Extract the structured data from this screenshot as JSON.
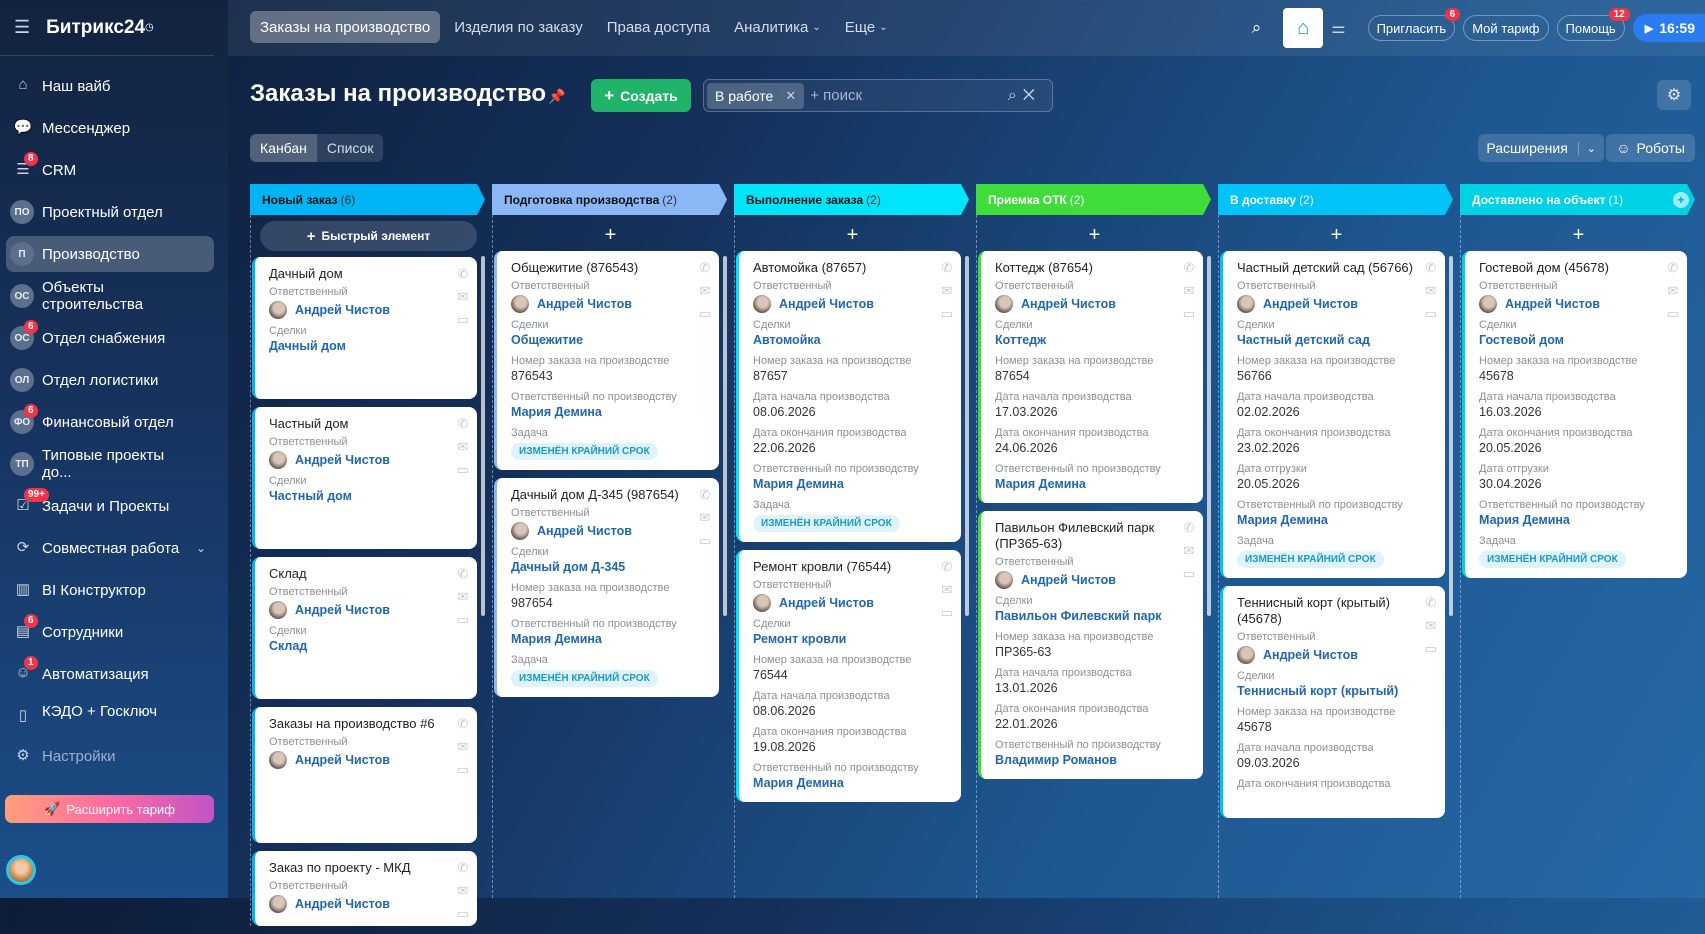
{
  "app": {
    "logo": "Битрикс24",
    "logo_mark": "◷"
  },
  "sidebar": {
    "items": [
      {
        "label": "Наш вайб",
        "icon": "home-icon",
        "glyph": "⌂"
      },
      {
        "label": "Мессенджер",
        "icon": "chat-icon",
        "glyph": "💬"
      },
      {
        "label": "CRM",
        "icon": "funnel-icon",
        "glyph": "☰",
        "badge": "8"
      },
      {
        "label": "Проектный отдел",
        "initials": "ПО"
      },
      {
        "label": "Производство",
        "initials": "П",
        "active": true
      },
      {
        "label": "Объекты строительства",
        "initials": "ОС"
      },
      {
        "label": "Отдел снабжения",
        "initials": "ОС",
        "badge": "6"
      },
      {
        "label": "Отдел логистики",
        "initials": "ОЛ"
      },
      {
        "label": "Финансовый отдел",
        "initials": "ФО",
        "badge": "6"
      },
      {
        "label": "Типовые проекты до...",
        "initials": "ТП"
      },
      {
        "label": "Задачи и Проекты",
        "icon": "tasks-icon",
        "glyph": "☑",
        "badge": "99+"
      },
      {
        "label": "Совместная работа",
        "icon": "collab-icon",
        "glyph": "⟳",
        "chevron": true
      },
      {
        "label": "BI Конструктор",
        "icon": "bar-chart-icon",
        "glyph": "▥"
      },
      {
        "label": "Сотрудники",
        "icon": "employees-icon",
        "glyph": "▤",
        "badge": "6"
      },
      {
        "label": "Автоматизация",
        "icon": "robot-icon",
        "glyph": "☺",
        "badge": "1"
      },
      {
        "label": "КЭДО + Госключ",
        "icon": "document-icon",
        "glyph": "▯"
      },
      {
        "label": "Настройки",
        "icon": "gear-icon",
        "glyph": "⚙",
        "dim": true
      }
    ],
    "upgrade": "Расширить тариф"
  },
  "topbar": {
    "tabs": [
      "Заказы на производство",
      "Изделия по заказу",
      "Права доступа",
      "Аналитика",
      "Еще"
    ],
    "invite": "Пригласить",
    "invite_badge": "6",
    "tariff": "Мой тариф",
    "help": "Помощь",
    "help_badge": "12",
    "clock": "16:59"
  },
  "header": {
    "title": "Заказы на производство",
    "create": "Создать",
    "filter_chip": "В работе",
    "search_placeholder": "+ поиск",
    "views": [
      "Канбан",
      "Список"
    ],
    "extensions": "Расширения",
    "robots": "Роботы"
  },
  "quick_add": "Быстрый элемент",
  "columns": [
    {
      "title": "Новый заказ",
      "count": "(6)",
      "color": "#00b4f5",
      "cards": [
        {
          "title": "Дачный дом",
          "min": 142,
          "fields": [
            {
              "l": "Ответственный",
              "v": "Андрей Чистов",
              "t": "person"
            },
            {
              "l": "Сделки",
              "v": "Дачный дом",
              "t": "link"
            }
          ]
        },
        {
          "title": "Частный дом",
          "min": 142,
          "fields": [
            {
              "l": "Ответственный",
              "v": "Андрей Чистов",
              "t": "person"
            },
            {
              "l": "Сделки",
              "v": "Частный дом",
              "t": "link"
            }
          ]
        },
        {
          "title": "Склад",
          "min": 142,
          "fields": [
            {
              "l": "Ответственный",
              "v": "Андрей Чистов",
              "t": "person"
            },
            {
              "l": "Сделки",
              "v": "Склад",
              "t": "link"
            }
          ]
        },
        {
          "title": "Заказы на производство #6",
          "min": 136,
          "fields": [
            {
              "l": "Ответственный",
              "v": "Андрей Чистов",
              "t": "person"
            }
          ]
        },
        {
          "title": "Заказ по проекту - МКД",
          "fields": [
            {
              "l": "Ответственный",
              "v": "Андрей Чистов",
              "t": "person"
            }
          ]
        }
      ]
    },
    {
      "title": "Подготовка производства",
      "count": "(2)",
      "color": "#8ab8f7",
      "cards": [
        {
          "title": "Общежитие (876543)",
          "fields": [
            {
              "l": "Ответственный",
              "v": "Андрей Чистов",
              "t": "person"
            },
            {
              "l": "Сделки",
              "v": "Общежитие",
              "t": "link"
            },
            {
              "l": "Номер заказа на производстве",
              "v": "876543"
            },
            {
              "l": "Ответственный по производству",
              "v": "Мария Демина",
              "t": "link"
            },
            {
              "l": "Задача",
              "v": "ИЗМЕНЁН КРАЙНИЙ СРОК",
              "t": "badge"
            }
          ]
        },
        {
          "title": "Дачный дом Д-345 (987654)",
          "fields": [
            {
              "l": "Ответственный",
              "v": "Андрей Чистов",
              "t": "person"
            },
            {
              "l": "Сделки",
              "v": "Дачный дом Д-345",
              "t": "link"
            },
            {
              "l": "Номер заказа на производстве",
              "v": "987654"
            },
            {
              "l": "Ответственный по производству",
              "v": "Мария Демина",
              "t": "link"
            },
            {
              "l": "Задача",
              "v": "ИЗМЕНЁН КРАЙНИЙ СРОК",
              "t": "badge"
            }
          ]
        }
      ]
    },
    {
      "title": "Выполнение заказа",
      "count": "(2)",
      "color": "#00e5fa",
      "cards": [
        {
          "title": "Автомойка (87657)",
          "fields": [
            {
              "l": "Ответственный",
              "v": "Андрей Чистов",
              "t": "person"
            },
            {
              "l": "Сделки",
              "v": "Автомойка",
              "t": "link"
            },
            {
              "l": "Номер заказа на производстве",
              "v": "87657"
            },
            {
              "l": "Дата начала производства",
              "v": "08.06.2026"
            },
            {
              "l": "Дата окончания производства",
              "v": "22.06.2026"
            },
            {
              "l": "Ответственный по производству",
              "v": "Мария Демина",
              "t": "link"
            },
            {
              "l": "Задача",
              "v": "ИЗМЕНЁН КРАЙНИЙ СРОК",
              "t": "badge"
            }
          ]
        },
        {
          "title": "Ремонт кровли (76544)",
          "fields": [
            {
              "l": "Ответственный",
              "v": "Андрей Чистов",
              "t": "person"
            },
            {
              "l": "Сделки",
              "v": "Ремонт кровли",
              "t": "link"
            },
            {
              "l": "Номер заказа на производстве",
              "v": "76544"
            },
            {
              "l": "Дата начала производства",
              "v": "08.06.2026"
            },
            {
              "l": "Дата окончания производства",
              "v": "19.08.2026"
            },
            {
              "l": "Ответственный по производству",
              "v": "Мария Демина",
              "t": "link"
            }
          ]
        }
      ]
    },
    {
      "title": "Приемка ОТК",
      "count": "(2)",
      "color": "#3fdc3a",
      "light": true,
      "cards": [
        {
          "title": "Коттедж (87654)",
          "fields": [
            {
              "l": "Ответственный",
              "v": "Андрей Чистов",
              "t": "person"
            },
            {
              "l": "Сделки",
              "v": "Коттедж",
              "t": "link"
            },
            {
              "l": "Номер заказа на производстве",
              "v": "87654"
            },
            {
              "l": "Дата начала производства",
              "v": "17.03.2026"
            },
            {
              "l": "Дата окончания производства",
              "v": "24.06.2026"
            },
            {
              "l": "Ответственный по производству",
              "v": "Мария Демина",
              "t": "link"
            }
          ]
        },
        {
          "title": "Павильон Филевский парк (ПР365-63)",
          "fields": [
            {
              "l": "Ответственный",
              "v": "Андрей Чистов",
              "t": "person"
            },
            {
              "l": "Сделки",
              "v": "Павильон Филевский парк",
              "t": "link"
            },
            {
              "l": "Номер заказа на производстве",
              "v": "ПР365-63"
            },
            {
              "l": "Дата начала производства",
              "v": "13.01.2026"
            },
            {
              "l": "Дата окончания производства",
              "v": "22.01.2026"
            },
            {
              "l": "Ответственный по производству",
              "v": "Владимир Романов",
              "t": "link"
            }
          ]
        }
      ]
    },
    {
      "title": "В доставку",
      "count": "(2)",
      "color": "#00c4f7",
      "light": true,
      "cards": [
        {
          "title": "Частный детский сад (56766)",
          "fields": [
            {
              "l": "Ответственный",
              "v": "Андрей Чистов",
              "t": "person"
            },
            {
              "l": "Сделки",
              "v": "Частный детский сад",
              "t": "link"
            },
            {
              "l": "Номер заказа на производстве",
              "v": "56766"
            },
            {
              "l": "Дата начала производства",
              "v": "02.02.2026"
            },
            {
              "l": "Дата окончания производства",
              "v": "23.02.2026"
            },
            {
              "l": "Дата отгрузки",
              "v": "20.05.2026"
            },
            {
              "l": "Ответственный по производству",
              "v": "Мария Демина",
              "t": "link"
            },
            {
              "l": "Задача",
              "v": "ИЗМЕНЁН КРАЙНИЙ СРОК",
              "t": "badge"
            }
          ]
        },
        {
          "title": "Теннисный корт (крытый) (45678)",
          "fields": [
            {
              "l": "Ответственный",
              "v": "Андрей Чистов",
              "t": "person"
            },
            {
              "l": "Сделки",
              "v": "Теннисный корт (крытый)",
              "t": "link"
            },
            {
              "l": "Номер заказа на производстве",
              "v": "45678"
            },
            {
              "l": "Дата начала производства",
              "v": "09.03.2026"
            },
            {
              "l": "Дата окончания производства",
              "v": ""
            }
          ]
        }
      ]
    },
    {
      "title": "Доставлено на объект",
      "count": "(1)",
      "color": "#00d2e6",
      "light": true,
      "cards": [
        {
          "title": "Гостевой дом (45678)",
          "fields": [
            {
              "l": "Ответственный",
              "v": "Андрей Чистов",
              "t": "person"
            },
            {
              "l": "Сделки",
              "v": "Гостевой дом",
              "t": "link"
            },
            {
              "l": "Номер заказа на производстве",
              "v": "45678"
            },
            {
              "l": "Дата начала производства",
              "v": "16.03.2026"
            },
            {
              "l": "Дата окончания производства",
              "v": "20.05.2026"
            },
            {
              "l": "Дата отгрузки",
              "v": "30.04.2026"
            },
            {
              "l": "Ответственный по производству",
              "v": "Мария Демина",
              "t": "link"
            },
            {
              "l": "Задача",
              "v": "ИЗМЕНЁН КРАЙНИЙ СРОК",
              "t": "badge"
            }
          ]
        }
      ]
    }
  ]
}
